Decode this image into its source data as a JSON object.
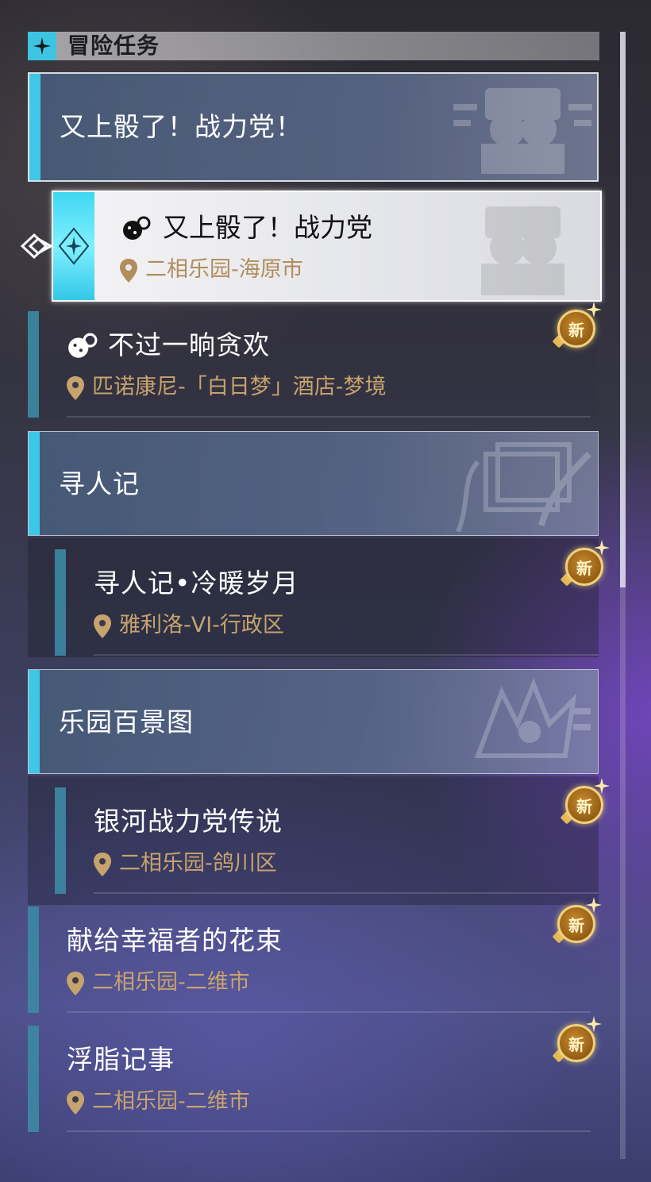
{
  "header": {
    "title": "冒险任务",
    "badge_icon": "diamond-star-icon"
  },
  "categories": [
    {
      "title": "又上骰了！战力党！",
      "quests": [
        {
          "title": "又上骰了！战力党",
          "location": "二相乐园-海原市",
          "selected": true,
          "quest_icon": "dice-quest-icon"
        },
        {
          "title": "不过一晌贪欢",
          "location": "匹诺康尼-「白日梦」酒店-梦境",
          "new_label": "新",
          "quest_icon": "dice-quest-icon"
        }
      ]
    },
    {
      "title": "寻人记",
      "quests": [
        {
          "title": "寻人记•冷暖岁月",
          "location": "雅利洛-VI-行政区",
          "new_label": "新"
        }
      ]
    },
    {
      "title": "乐园百景图",
      "quests": [
        {
          "title": "银河战力党传说",
          "location": "二相乐园-鸽川区",
          "new_label": "新"
        },
        {
          "title": "献给幸福者的花束",
          "location": "二相乐园-二维市",
          "new_label": "新"
        },
        {
          "title": "浮脂记事",
          "location": "二相乐园-二维市",
          "new_label": "新"
        }
      ]
    }
  ],
  "colors": {
    "accent": "#3ec8e6",
    "location_gold": "#c7a36e",
    "badge_gold": "#c98a2c"
  }
}
